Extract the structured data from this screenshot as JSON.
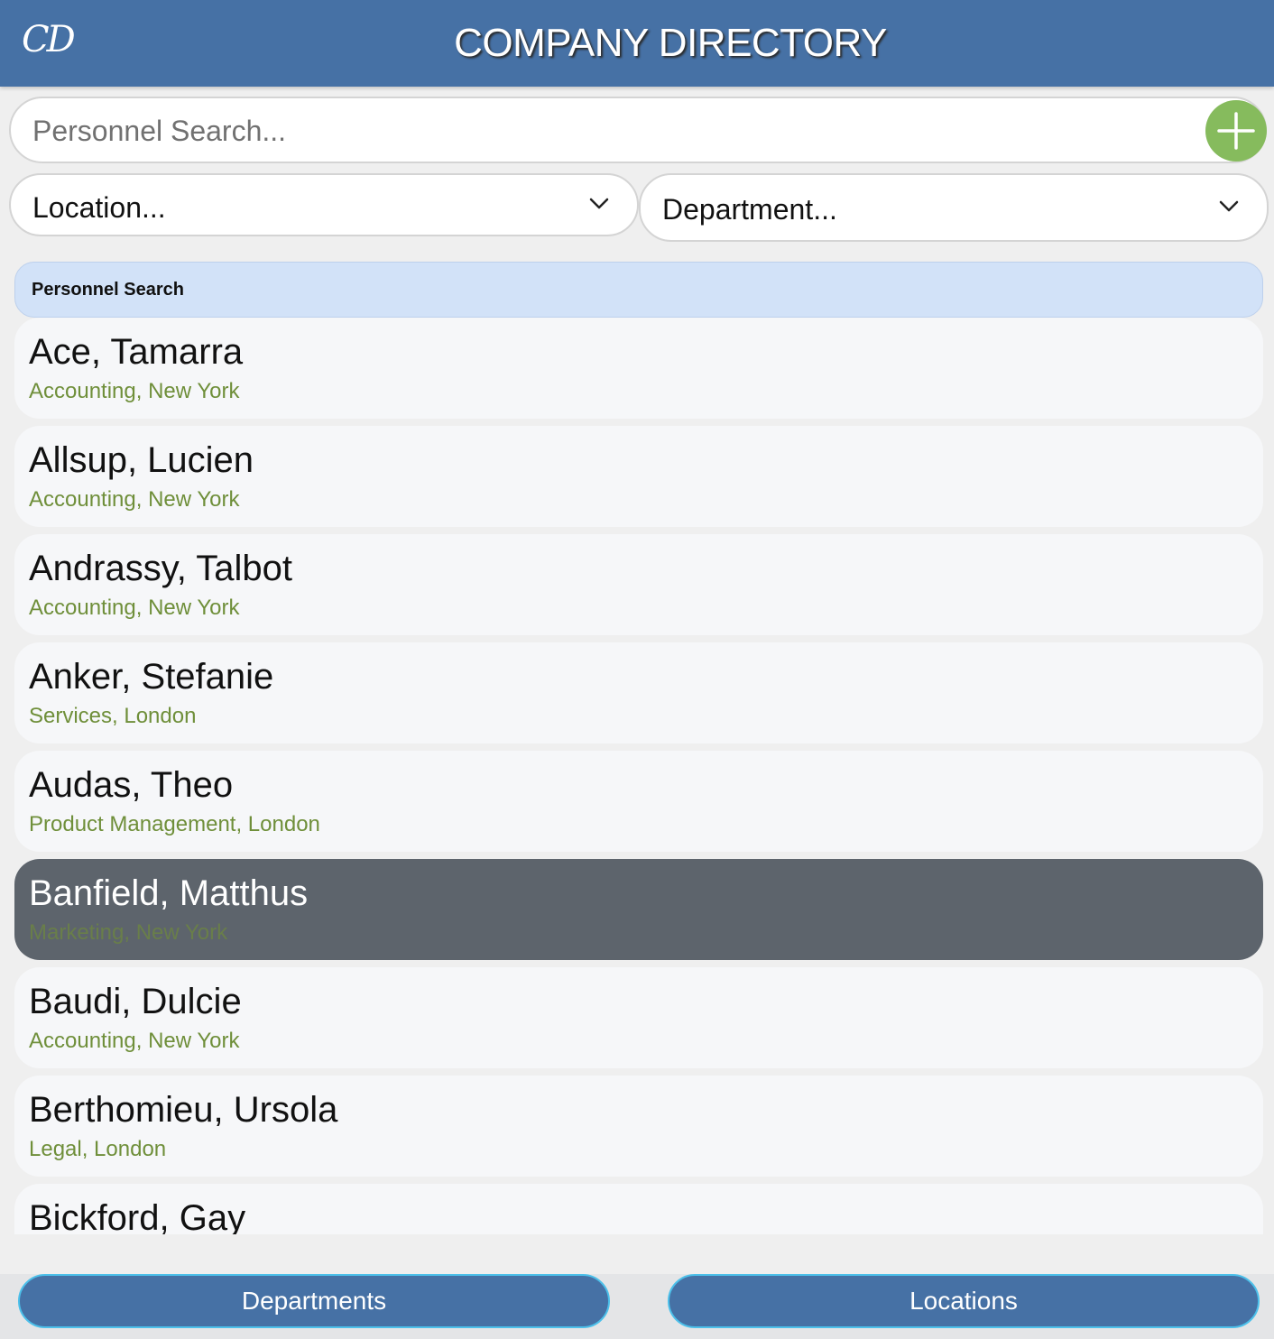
{
  "header": {
    "logo_text": "CD",
    "title": "COMPANY DIRECTORY"
  },
  "search": {
    "placeholder": "Personnel Search...",
    "value": ""
  },
  "filters": {
    "location_label": "Location...",
    "department_label": "Department..."
  },
  "list": {
    "header": "Personnel Search",
    "items": [
      {
        "name": "Ace, Tamarra",
        "detail": "Accounting, New York",
        "selected": false
      },
      {
        "name": "Allsup, Lucien",
        "detail": "Accounting, New York",
        "selected": false
      },
      {
        "name": "Andrassy, Talbot",
        "detail": "Accounting, New York",
        "selected": false
      },
      {
        "name": "Anker, Stefanie",
        "detail": "Services, London",
        "selected": false
      },
      {
        "name": "Audas, Theo",
        "detail": "Product Management, London",
        "selected": false
      },
      {
        "name": "Banfield, Matthus",
        "detail": "Marketing, New York",
        "selected": true
      },
      {
        "name": "Baudi, Dulcie",
        "detail": "Accounting, New York",
        "selected": false
      },
      {
        "name": "Berthomieu, Ursola",
        "detail": "Legal, London",
        "selected": false
      },
      {
        "name": "Bickford, Gay",
        "detail": "",
        "selected": false
      }
    ]
  },
  "footer": {
    "departments_label": "Departments",
    "locations_label": "Locations"
  },
  "colors": {
    "header_bg": "#4671a5",
    "add_button": "#86bb5d",
    "list_header_bg": "#d2e2f8",
    "selected_row_bg": "#5d646c",
    "detail_text": "#6f8f3a",
    "footer_button_border": "#4cc0ea"
  },
  "icons": {
    "add": "plus-icon",
    "dropdown": "chevron-down-icon"
  }
}
